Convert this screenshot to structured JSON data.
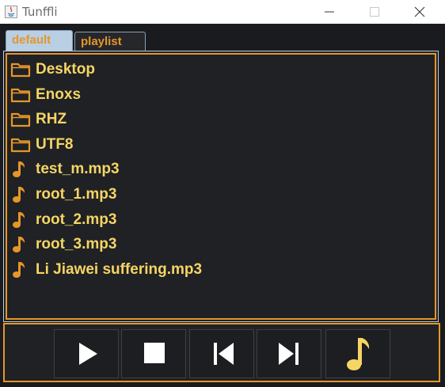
{
  "window": {
    "title": "Tunffli"
  },
  "tabs": [
    {
      "label": "default",
      "selected": true
    },
    {
      "label": "playlist",
      "selected": false
    }
  ],
  "files": [
    {
      "name": "Desktop",
      "type": "folder",
      "icon": "folder-icon"
    },
    {
      "name": "Enoxs",
      "type": "folder",
      "icon": "folder-icon"
    },
    {
      "name": "RHZ",
      "type": "folder",
      "icon": "folder-icon"
    },
    {
      "name": "UTF8",
      "type": "folder",
      "icon": "folder-icon"
    },
    {
      "name": "test_m.mp3",
      "type": "audio",
      "icon": "music-note-icon"
    },
    {
      "name": "root_1.mp3",
      "type": "audio",
      "icon": "music-note-icon"
    },
    {
      "name": "root_2.mp3",
      "type": "audio",
      "icon": "music-note-icon"
    },
    {
      "name": "root_3.mp3",
      "type": "audio",
      "icon": "music-note-icon"
    },
    {
      "name": "Li Jiawei suffering.mp3",
      "type": "audio",
      "icon": "music-note-icon"
    }
  ],
  "controls": [
    {
      "name": "play",
      "icon": "play-icon"
    },
    {
      "name": "stop",
      "icon": "stop-icon"
    },
    {
      "name": "previous",
      "icon": "skip-previous-icon"
    },
    {
      "name": "next",
      "icon": "skip-next-icon"
    },
    {
      "name": "music",
      "icon": "music-note-icon"
    }
  ],
  "colors": {
    "accent": "#e6962a",
    "text": "#f5d565",
    "background": "#1f2124",
    "tab_selected": "#b8cfe4"
  }
}
